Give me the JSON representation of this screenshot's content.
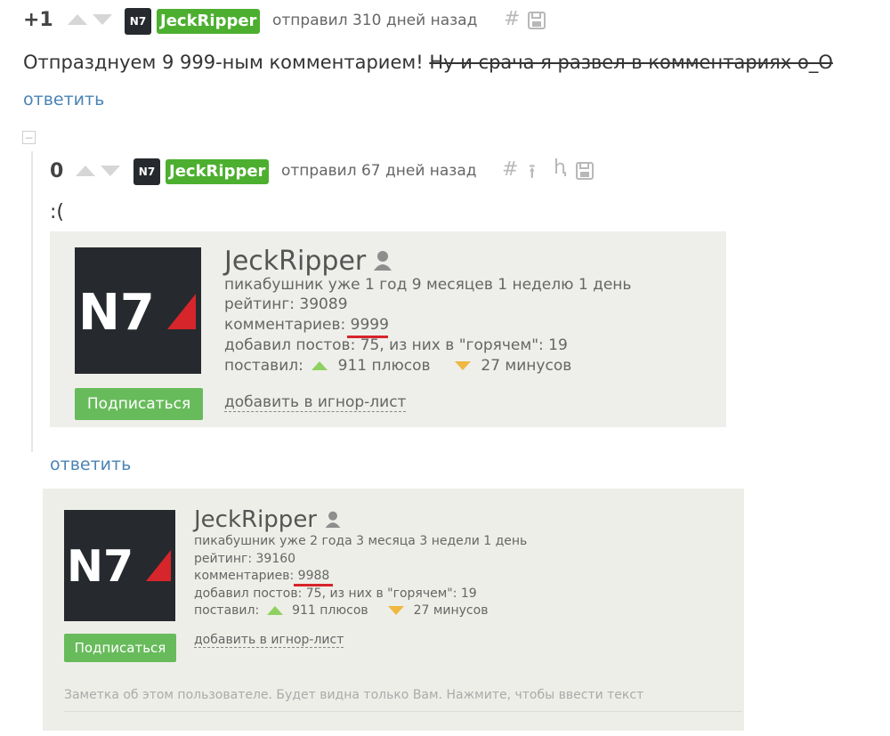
{
  "comment1": {
    "score": "+1",
    "avatar_text": "N7",
    "username": "JeckRipper",
    "meta": "отправил 310 дней назад",
    "hash": "#",
    "body_text": "Отпразднуем 9 999-ным комментарием!",
    "body_struck": "Ну и срача я развел в комментариях о_О",
    "reply": "ответить",
    "collapse": "−"
  },
  "comment2": {
    "score": "0",
    "avatar_text": "N7",
    "username": "JeckRipper",
    "meta": "отправил 67 дней назад",
    "hash": "#",
    "up_tool": "⭱",
    "branch_tool": "ⱨ",
    "body_text": ":(",
    "reply": "ответить"
  },
  "profile1": {
    "avatar_text": "N7",
    "name": "JeckRipper",
    "tenure": "пикабушник уже 1 год 9 месяцев 1 неделю 1 день",
    "rating": "рейтинг: 39089",
    "comments_label": "комментариев: ",
    "comments_value": "9999",
    "posts": "добавил постов: 75, из них в \"горячем\": 19",
    "voted_label": "поставил:",
    "pluses": "911 плюсов",
    "minuses": "27 минусов",
    "subscribe": "Подписаться",
    "ignore": "добавить в игнор-лист"
  },
  "profile2": {
    "avatar_text": "N7",
    "name": "JeckRipper",
    "tenure": "пикабушник уже 2 года 3 месяца 3 недели 1 день",
    "rating": "рейтинг: 39160",
    "comments_label": "комментариев: ",
    "comments_value": "9988",
    "posts": "добавил постов: 75, из них в \"горячем\": 19",
    "voted_label": "поставил:",
    "pluses": "911 плюсов",
    "minuses": "27 минусов",
    "subscribe": "Подписаться",
    "ignore": "добавить в игнор-лист",
    "note_placeholder": "Заметка об этом пользователе. Будет видна только Вам. Нажмите, чтобы ввести текст"
  },
  "colors": {
    "username_bg": "#4caf2f",
    "reply_link": "#4a83b5",
    "subscribe_bg": "#68bb5b",
    "plus_arrow": "#8fd160",
    "minus_arrow": "#f0b840",
    "underline_mark": "#d7242a"
  },
  "icons": [
    "hash-icon",
    "save-icon",
    "go-parent-icon",
    "branch-icon",
    "user-icon",
    "collapse-icon"
  ]
}
